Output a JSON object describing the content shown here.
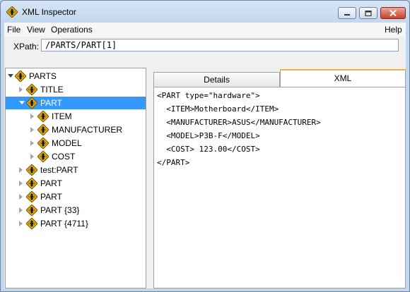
{
  "window": {
    "title": "XML Inspector",
    "icon": "xml-diamond-icon",
    "controls": [
      "minimize-icon",
      "maximize-icon",
      "close-icon"
    ]
  },
  "menu": {
    "file": "File",
    "view": "View",
    "operations": "Operations",
    "help": "Help"
  },
  "xpath": {
    "label": "XPath:",
    "value": "/PARTS/PART[1]"
  },
  "tree": [
    {
      "label": "PARTS",
      "depth": 0,
      "expander": "expanded",
      "selected": false
    },
    {
      "label": "TITLE",
      "depth": 1,
      "expander": "collapsed",
      "selected": false
    },
    {
      "label": "PART",
      "depth": 1,
      "expander": "expanded",
      "selected": true
    },
    {
      "label": "ITEM",
      "depth": 2,
      "expander": "collapsed",
      "selected": false
    },
    {
      "label": "MANUFACTURER",
      "depth": 2,
      "expander": "collapsed",
      "selected": false
    },
    {
      "label": "MODEL",
      "depth": 2,
      "expander": "collapsed",
      "selected": false
    },
    {
      "label": "COST",
      "depth": 2,
      "expander": "collapsed",
      "selected": false
    },
    {
      "label": "test:PART",
      "depth": 1,
      "expander": "collapsed",
      "selected": false
    },
    {
      "label": "PART",
      "depth": 1,
      "expander": "collapsed",
      "selected": false
    },
    {
      "label": "PART",
      "depth": 1,
      "expander": "collapsed",
      "selected": false
    },
    {
      "label": "PART {33}",
      "depth": 1,
      "expander": "collapsed",
      "selected": false
    },
    {
      "label": "PART {4711}",
      "depth": 1,
      "expander": "collapsed",
      "selected": false
    }
  ],
  "tabs": {
    "details": "Details",
    "xml": "XML",
    "active": "XML"
  },
  "xml_lines": [
    "<PART type=\"hardware\">",
    "  <ITEM>Motherboard</ITEM>",
    "  <MANUFACTURER>ASUS</MANUFACTURER>",
    "  <MODEL>P3B-F</MODEL>",
    "  <COST> 123.00</COST>",
    "</PART>"
  ],
  "colors": {
    "selection": "#3399ff",
    "icon_fill": "#f2b705",
    "active_tab_accent": "#f5b041"
  }
}
